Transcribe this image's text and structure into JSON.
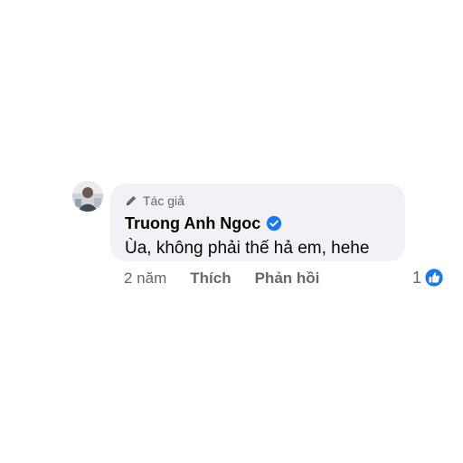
{
  "comment": {
    "badge_label": "Tác giả",
    "author_name": "Truong Anh Ngoc",
    "verified": true,
    "text": "Ùa, không phải thế hả em, hehe",
    "time": "2 năm",
    "like_label": "Thích",
    "reply_label": "Phản hồi",
    "reaction_count": "1",
    "reaction_type": "like-icon"
  },
  "colors": {
    "bubble_background": "#f0f2f5",
    "secondary_text": "#65676b",
    "primary_text": "#050505",
    "accent_blue": "#1877f2"
  }
}
